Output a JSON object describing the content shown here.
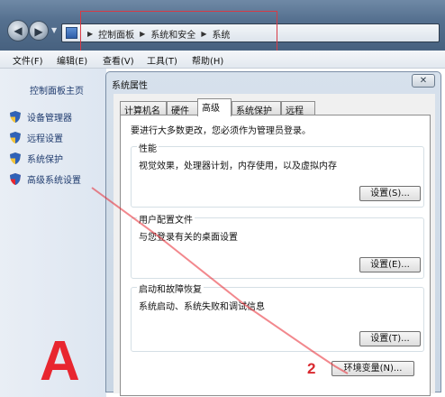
{
  "address_bar": {
    "crumbs": [
      "控制面板",
      "系统和安全",
      "系统"
    ]
  },
  "menu": {
    "items": [
      "文件(F)",
      "编辑(E)",
      "查看(V)",
      "工具(T)",
      "帮助(H)"
    ]
  },
  "left_pane": {
    "home": "控制面板主页",
    "items": [
      {
        "label": "设备管理器",
        "icon": "shield-icon"
      },
      {
        "label": "远程设置",
        "icon": "shield-icon"
      },
      {
        "label": "系统保护",
        "icon": "shield-icon"
      },
      {
        "label": "高级系统设置",
        "icon": "shield-icon"
      }
    ]
  },
  "dialog": {
    "title": "系统属性",
    "close_label": "✕",
    "tabs": [
      "计算机名",
      "硬件",
      "高级",
      "系统保护",
      "远程"
    ],
    "active_tab": "高级",
    "intro": "要进行大多数更改，您必须作为管理员登录。",
    "groups": [
      {
        "title": "性能",
        "desc": "视觉效果，处理器计划，内存使用，以及虚拟内存",
        "button": "设置(S)..."
      },
      {
        "title": "用户配置文件",
        "desc": "与您登录有关的桌面设置",
        "button": "设置(E)..."
      },
      {
        "title": "启动和故障恢复",
        "desc": "系统启动、系统失败和调试信息",
        "button": "设置(T)..."
      }
    ],
    "env_button": "环境变量(N)..."
  },
  "annotations": {
    "letter": "A",
    "step": "2"
  },
  "colors": {
    "annotation_red": "#e8262f",
    "link_blue": "#1f3b6e"
  }
}
